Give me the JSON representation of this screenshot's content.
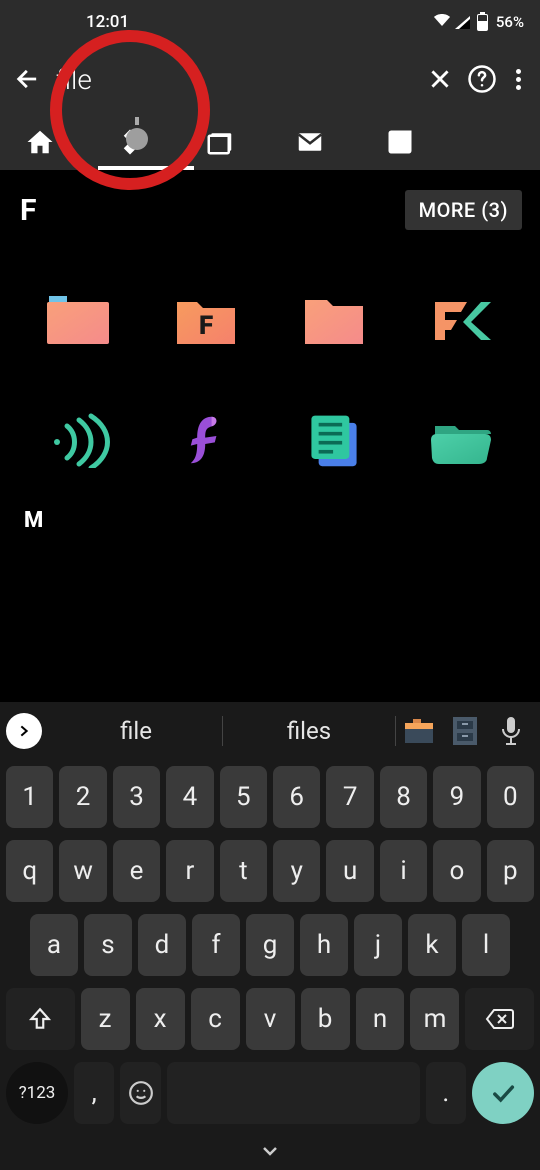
{
  "status": {
    "time": "12:01",
    "battery_pct": "56%"
  },
  "search": {
    "value": "file"
  },
  "section": {
    "letter": "F",
    "more_label": "MORE (3)"
  },
  "next_section_letter": "M",
  "suggestions": {
    "w1": "file",
    "w2": "files"
  },
  "keys": {
    "row1": [
      "1",
      "2",
      "3",
      "4",
      "5",
      "6",
      "7",
      "8",
      "9",
      "0"
    ],
    "row2": [
      "q",
      "w",
      "e",
      "r",
      "t",
      "y",
      "u",
      "i",
      "o",
      "p"
    ],
    "row3": [
      "a",
      "s",
      "d",
      "f",
      "g",
      "h",
      "j",
      "k",
      "l"
    ],
    "row4": [
      "z",
      "x",
      "c",
      "v",
      "b",
      "n",
      "m"
    ],
    "sym": "?123",
    "comma": ",",
    "period": "."
  }
}
